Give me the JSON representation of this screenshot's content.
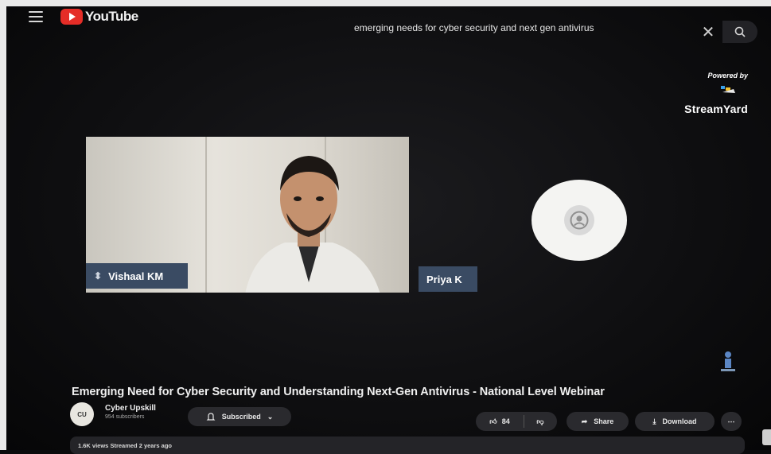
{
  "header": {
    "logo_text": "YouTube",
    "search_query": "emerging needs for cyber security and next gen antivirus",
    "icons": [
      "menu-icon",
      "youtube-play-icon",
      "close-icon",
      "search-icon"
    ]
  },
  "video": {
    "overlay_powered": "Powered by",
    "overlay_brand": "StreamYard",
    "participants": [
      {
        "name": "Vishaal KM",
        "video_on": true
      },
      {
        "name": "Priya K",
        "video_on": false
      }
    ]
  },
  "meta": {
    "title": "Emerging Need for Cyber Security and Understanding Next-Gen Antivirus - National Level Webinar",
    "channel_name": "Cyber Upskill",
    "channel_subscribers": "954 subscribers",
    "subscribe_label": "Subscribed",
    "like_count": "84",
    "share_label": "Share",
    "download_label": "Download",
    "description_summary": "1.6K views  Streamed 2 years ago"
  },
  "colors": {
    "youtube_red": "#e52d27",
    "name_tag": "#3a4b63",
    "pill_bg": "#2a2a2e"
  }
}
